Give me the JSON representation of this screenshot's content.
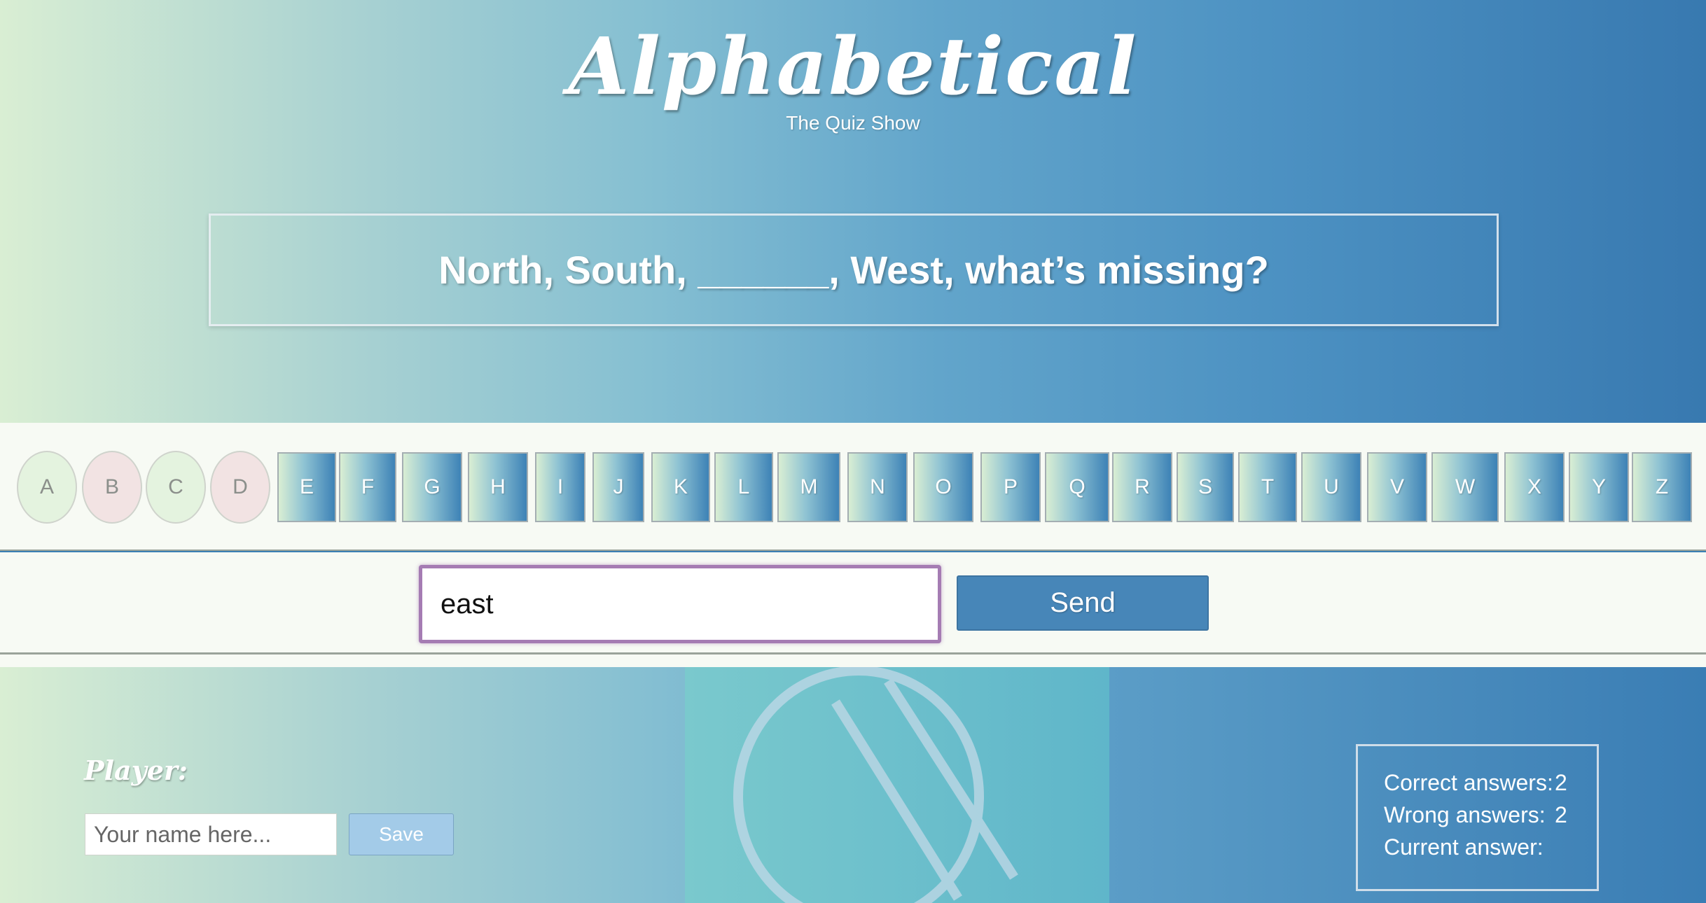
{
  "header": {
    "title": "Alphabetical",
    "subtitle": "The Quiz Show"
  },
  "question": {
    "text": "North, South, ______, West, what’s missing?"
  },
  "letters": {
    "used": [
      {
        "label": "A",
        "status": "correct",
        "color": "#e4f3df"
      },
      {
        "label": "B",
        "status": "wrong",
        "color": "#f2e3e3"
      },
      {
        "label": "C",
        "status": "correct",
        "color": "#e4f3df"
      },
      {
        "label": "D",
        "status": "wrong",
        "color": "#f2e3e3"
      }
    ],
    "remaining": [
      "E",
      "F",
      "G",
      "H",
      "I",
      "J",
      "K",
      "L",
      "M",
      "N",
      "O",
      "P",
      "Q",
      "R",
      "S",
      "T",
      "U",
      "V",
      "W",
      "X",
      "Y",
      "Z"
    ]
  },
  "answer": {
    "value": "east",
    "send_label": "Send"
  },
  "player": {
    "label": "Player:",
    "name_placeholder": "Your name here...",
    "save_label": "Save"
  },
  "stats": {
    "correct_label": "Correct answers:",
    "correct_value": "2",
    "wrong_label": "Wrong answers:",
    "wrong_value": "2",
    "current_label": "Current answer:",
    "current_value": ""
  },
  "center_icon": "no-entry-icon",
  "colors": {
    "accent": "#4786b8",
    "input_focus": "#a57cb3",
    "correct_letter": "#e4f3df",
    "wrong_letter": "#f2e3e3"
  }
}
